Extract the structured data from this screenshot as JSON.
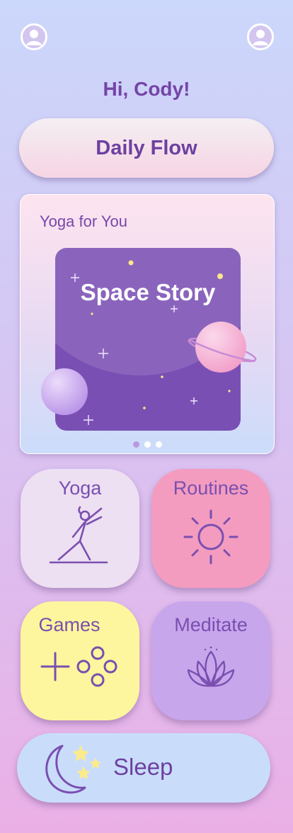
{
  "header": {
    "left_avatar_icon": "profile-avatar-icon",
    "right_avatar_icon": "profile-avatar-icon",
    "greeting": "Hi, Cody!"
  },
  "daily_flow": {
    "label": "Daily Flow"
  },
  "featured": {
    "title": "Yoga for You",
    "story_title": "Space Story",
    "carousel": {
      "count": 3,
      "active_index": 0
    }
  },
  "tiles": {
    "yoga": {
      "label": "Yoga",
      "icon": "yoga-pose-icon",
      "color": "#ede0f2"
    },
    "routines": {
      "label": "Routines",
      "icon": "sun-icon",
      "color": "#f39cc0"
    },
    "games": {
      "label": "Games",
      "icon": "gamepad-icon",
      "color": "#fef69e"
    },
    "meditate": {
      "label": "Meditate",
      "icon": "lotus-icon",
      "color": "#c7a6ec"
    }
  },
  "sleep": {
    "label": "Sleep",
    "icon": "moon-stars-icon",
    "color": "#c9ddfb"
  },
  "colors": {
    "accent_purple": "#7444a6",
    "story_bg": "#7a4fb3"
  }
}
